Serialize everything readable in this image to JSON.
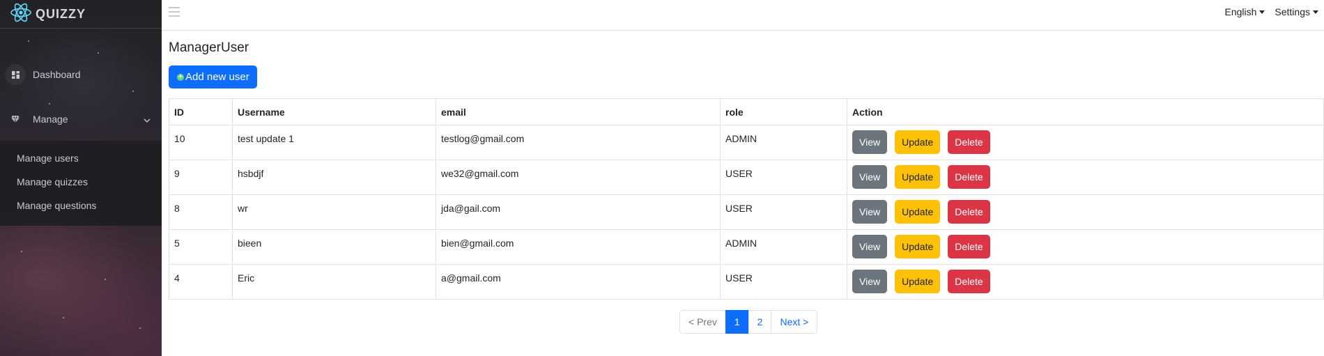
{
  "brand": {
    "name": "QUIZZY",
    "icon": "react-atom-icon",
    "color": "#61dafb"
  },
  "sidebar": {
    "items": [
      {
        "label": "Dashboard",
        "icon": "dashboard-icon"
      },
      {
        "label": "Manage",
        "icon": "gem-icon"
      }
    ],
    "submenu": [
      {
        "label": "Manage users"
      },
      {
        "label": "Manage quizzes"
      },
      {
        "label": "Manage questions"
      }
    ]
  },
  "topbar": {
    "language": "English",
    "settings": "Settings"
  },
  "main": {
    "title": "ManagerUser",
    "add_button": "Add new user"
  },
  "table": {
    "headers": [
      "ID",
      "Username",
      "email",
      "role",
      "Action"
    ],
    "rows": [
      {
        "id": "10",
        "username": "test update 1",
        "email": "testlog@gmail.com",
        "role": "ADMIN"
      },
      {
        "id": "9",
        "username": "hsbdjf",
        "email": "we32@gmail.com",
        "role": "USER"
      },
      {
        "id": "8",
        "username": "wr",
        "email": "jda@gail.com",
        "role": "USER"
      },
      {
        "id": "5",
        "username": "bieen",
        "email": "bien@gmail.com",
        "role": "ADMIN"
      },
      {
        "id": "4",
        "username": "Eric",
        "email": "a@gmail.com",
        "role": "USER"
      }
    ],
    "actions": {
      "view": "View",
      "update": "Update",
      "delete": "Delete"
    }
  },
  "pagination": {
    "prev": "< Prev",
    "pages": [
      "1",
      "2"
    ],
    "current": "1",
    "next": "Next >"
  },
  "colors": {
    "primary": "#0d6efd",
    "secondary": "#6c757d",
    "warning": "#ffc107",
    "danger": "#dc3545"
  }
}
